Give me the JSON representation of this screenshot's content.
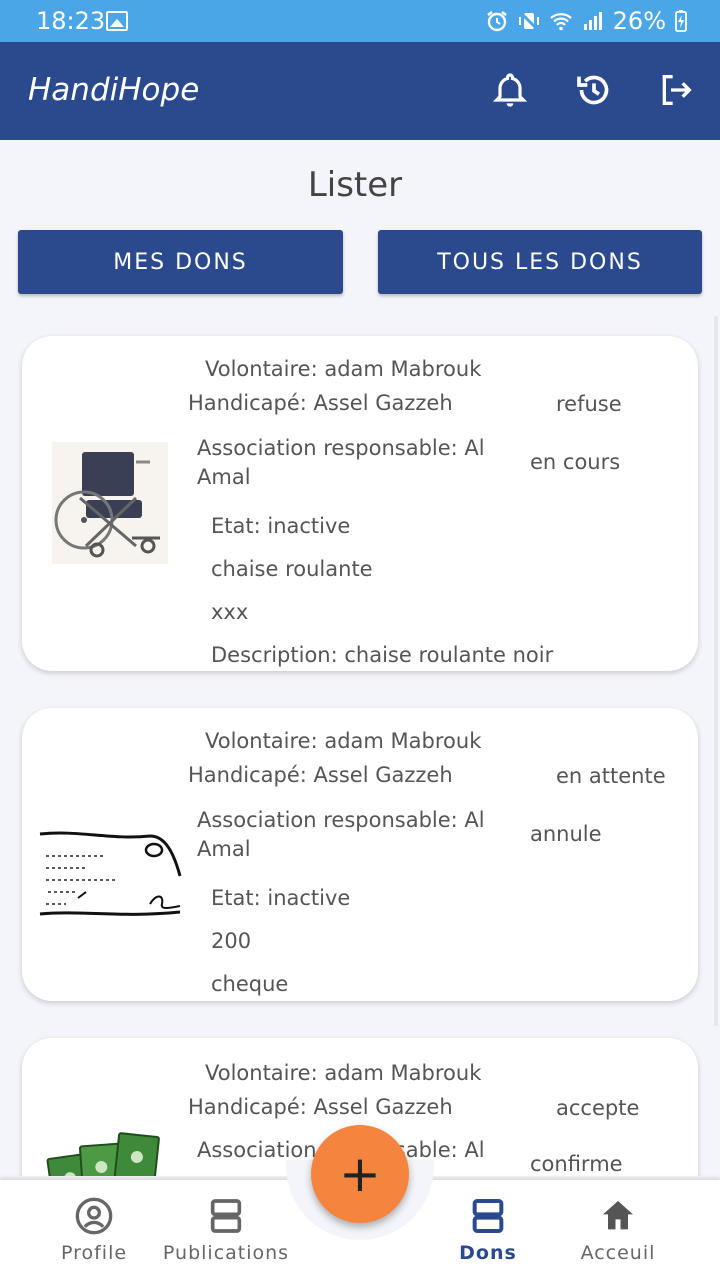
{
  "status_bar": {
    "time": "18:23",
    "battery": "26%"
  },
  "app_bar": {
    "title": "HandiHope"
  },
  "page": {
    "title": "Lister",
    "btn_mes_dons": "MES DONS",
    "btn_tous_les_dons": "TOUS LES DONS"
  },
  "dons": [
    {
      "volontaire": "Volontaire: adam Mabrouk",
      "handicape": "Handicapé: Assel Gazzeh",
      "association": "Association responsable: Al Amal",
      "status1": "refuse",
      "status2": "en cours",
      "etat": "Etat: inactive",
      "field1": "chaise roulante",
      "field2": "xxx",
      "description": "Description: chaise roulante noir",
      "image": "wheelchair"
    },
    {
      "volontaire": "Volontaire: adam Mabrouk",
      "handicape": "Handicapé: Assel Gazzeh",
      "association": "Association responsable: Al Amal",
      "status1": "en attente",
      "status2": "annule",
      "etat": "Etat: inactive",
      "field1": "200",
      "field2": "cheque",
      "image": "cheque"
    },
    {
      "volontaire": "Volontaire: adam Mabrouk",
      "handicape": "Handicapé: Assel Gazzeh",
      "association": "Association responsable: Al",
      "status1": "accepte",
      "status2": "confirme",
      "image": "money"
    }
  ],
  "bottom_nav": {
    "profile": "Profile",
    "publications": "Publications",
    "dons": "Dons",
    "accueil": "Acceuil",
    "fab": "+"
  },
  "colors": {
    "primary": "#2b4a8e",
    "status_bar": "#4aa6e6",
    "fab": "#f4843e"
  }
}
